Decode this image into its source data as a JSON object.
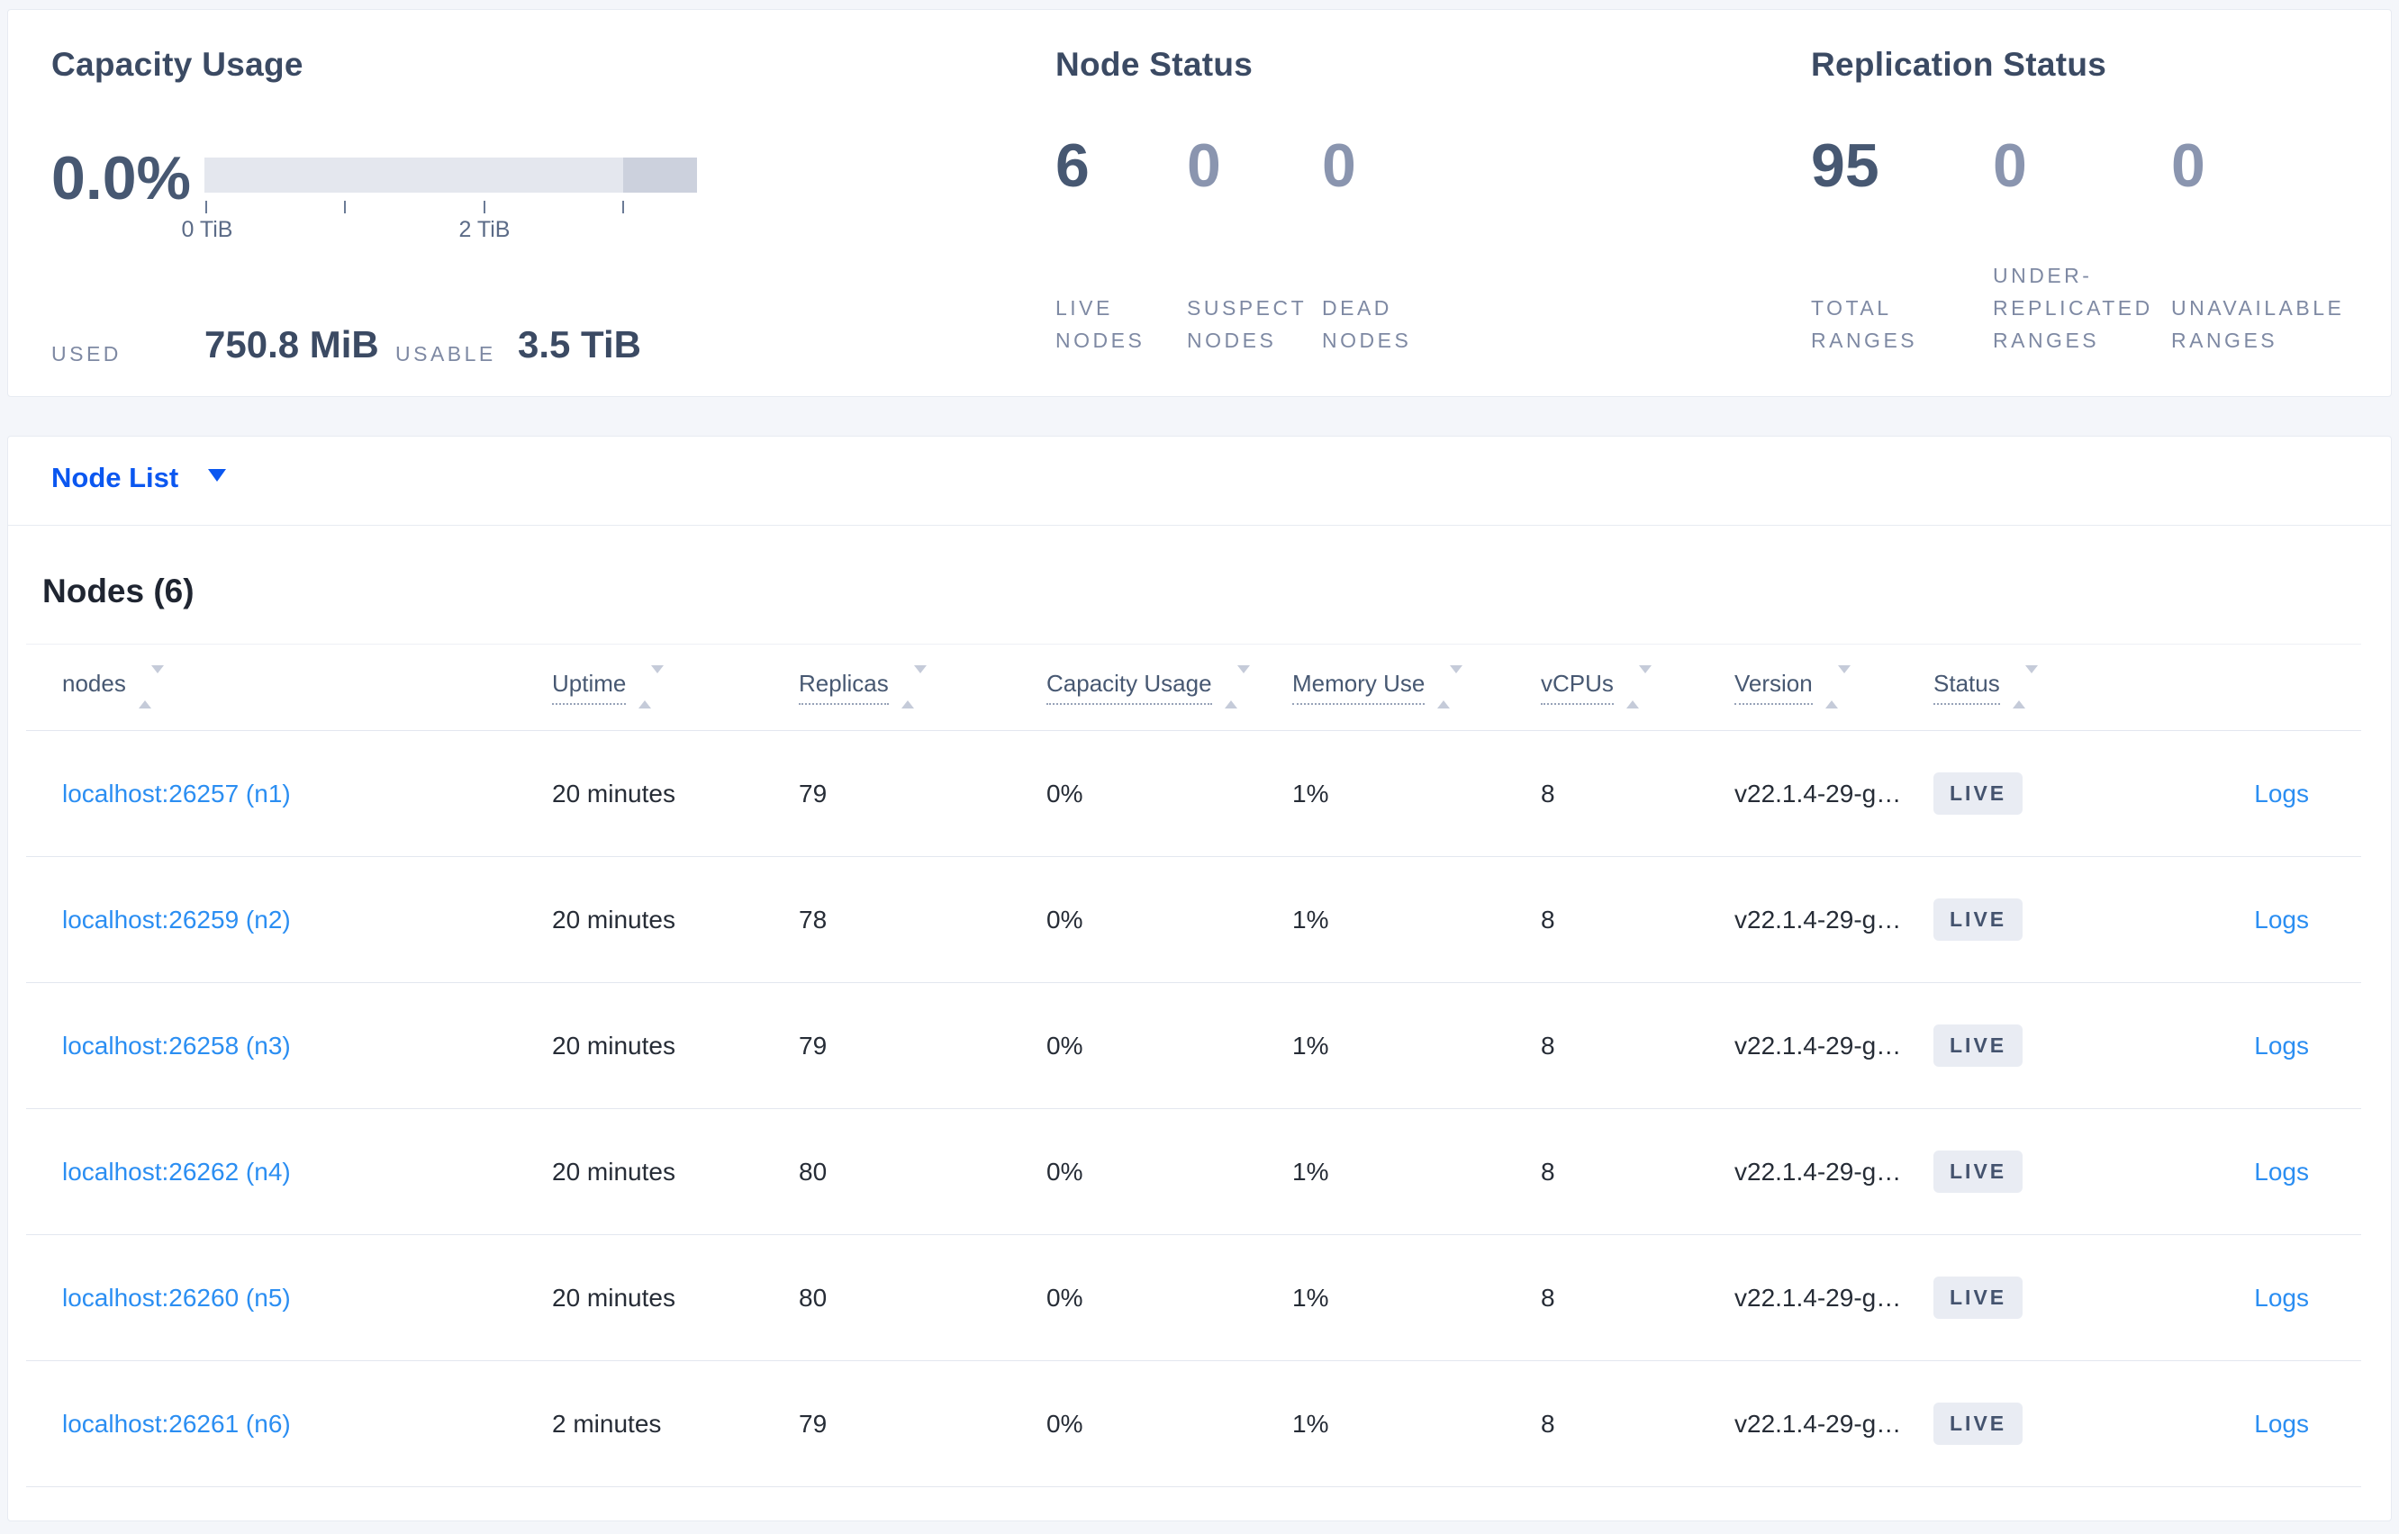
{
  "colors": {
    "page_bg": "#f4f6fa",
    "panel_border": "#e7ebf2",
    "accent_blue": "#0b57f0",
    "link_blue": "#2b8ef2",
    "dark_slate": "#475872",
    "muted_label": "#7e89a3",
    "badge_bg": "#e9ecf3",
    "bar_track": "#e4e7ee",
    "bar_dark_segment": "#ccd1dd"
  },
  "cards": {
    "capacity": {
      "title": "Capacity Usage",
      "percent": "0.0%",
      "tick_labels": {
        "zero": "0 TiB",
        "two": "2 TiB"
      },
      "used_label": "USED",
      "used_value": "750.8 MiB",
      "usable_label": "USABLE",
      "usable_value": "3.5 TiB"
    },
    "node_status": {
      "title": "Node Status",
      "metrics": [
        {
          "value": "6",
          "label": "LIVE NODES"
        },
        {
          "value": "0",
          "label": "SUSPECT NODES"
        },
        {
          "value": "0",
          "label": "DEAD NODES"
        }
      ]
    },
    "replication": {
      "title": "Replication Status",
      "metrics": [
        {
          "value": "95",
          "label": "TOTAL RANGES"
        },
        {
          "value": "0",
          "label": "UNDER-REPLICATED RANGES"
        },
        {
          "value": "0",
          "label": "UNAVAILABLE RANGES"
        }
      ]
    }
  },
  "node_list": {
    "dropdown_label": "Node List",
    "heading": "Nodes (6)",
    "columns": [
      {
        "label": "nodes"
      },
      {
        "label": "Uptime"
      },
      {
        "label": "Replicas"
      },
      {
        "label": "Capacity Usage"
      },
      {
        "label": "Memory Use"
      },
      {
        "label": "vCPUs"
      },
      {
        "label": "Version"
      },
      {
        "label": "Status"
      }
    ],
    "rows": [
      {
        "address": "localhost:26257 (n1)",
        "uptime": "20 minutes",
        "replicas": "79",
        "capacity_usage": "0%",
        "memory_use": "1%",
        "vcpus": "8",
        "version": "v22.1.4-29-g…",
        "status": "LIVE",
        "logs": "Logs"
      },
      {
        "address": "localhost:26259 (n2)",
        "uptime": "20 minutes",
        "replicas": "78",
        "capacity_usage": "0%",
        "memory_use": "1%",
        "vcpus": "8",
        "version": "v22.1.4-29-g…",
        "status": "LIVE",
        "logs": "Logs"
      },
      {
        "address": "localhost:26258 (n3)",
        "uptime": "20 minutes",
        "replicas": "79",
        "capacity_usage": "0%",
        "memory_use": "1%",
        "vcpus": "8",
        "version": "v22.1.4-29-g…",
        "status": "LIVE",
        "logs": "Logs"
      },
      {
        "address": "localhost:26262 (n4)",
        "uptime": "20 minutes",
        "replicas": "80",
        "capacity_usage": "0%",
        "memory_use": "1%",
        "vcpus": "8",
        "version": "v22.1.4-29-g…",
        "status": "LIVE",
        "logs": "Logs"
      },
      {
        "address": "localhost:26260 (n5)",
        "uptime": "20 minutes",
        "replicas": "80",
        "capacity_usage": "0%",
        "memory_use": "1%",
        "vcpus": "8",
        "version": "v22.1.4-29-g…",
        "status": "LIVE",
        "logs": "Logs"
      },
      {
        "address": "localhost:26261 (n6)",
        "uptime": "2 minutes",
        "replicas": "79",
        "capacity_usage": "0%",
        "memory_use": "1%",
        "vcpus": "8",
        "version": "v22.1.4-29-g…",
        "status": "LIVE",
        "logs": "Logs"
      }
    ]
  }
}
